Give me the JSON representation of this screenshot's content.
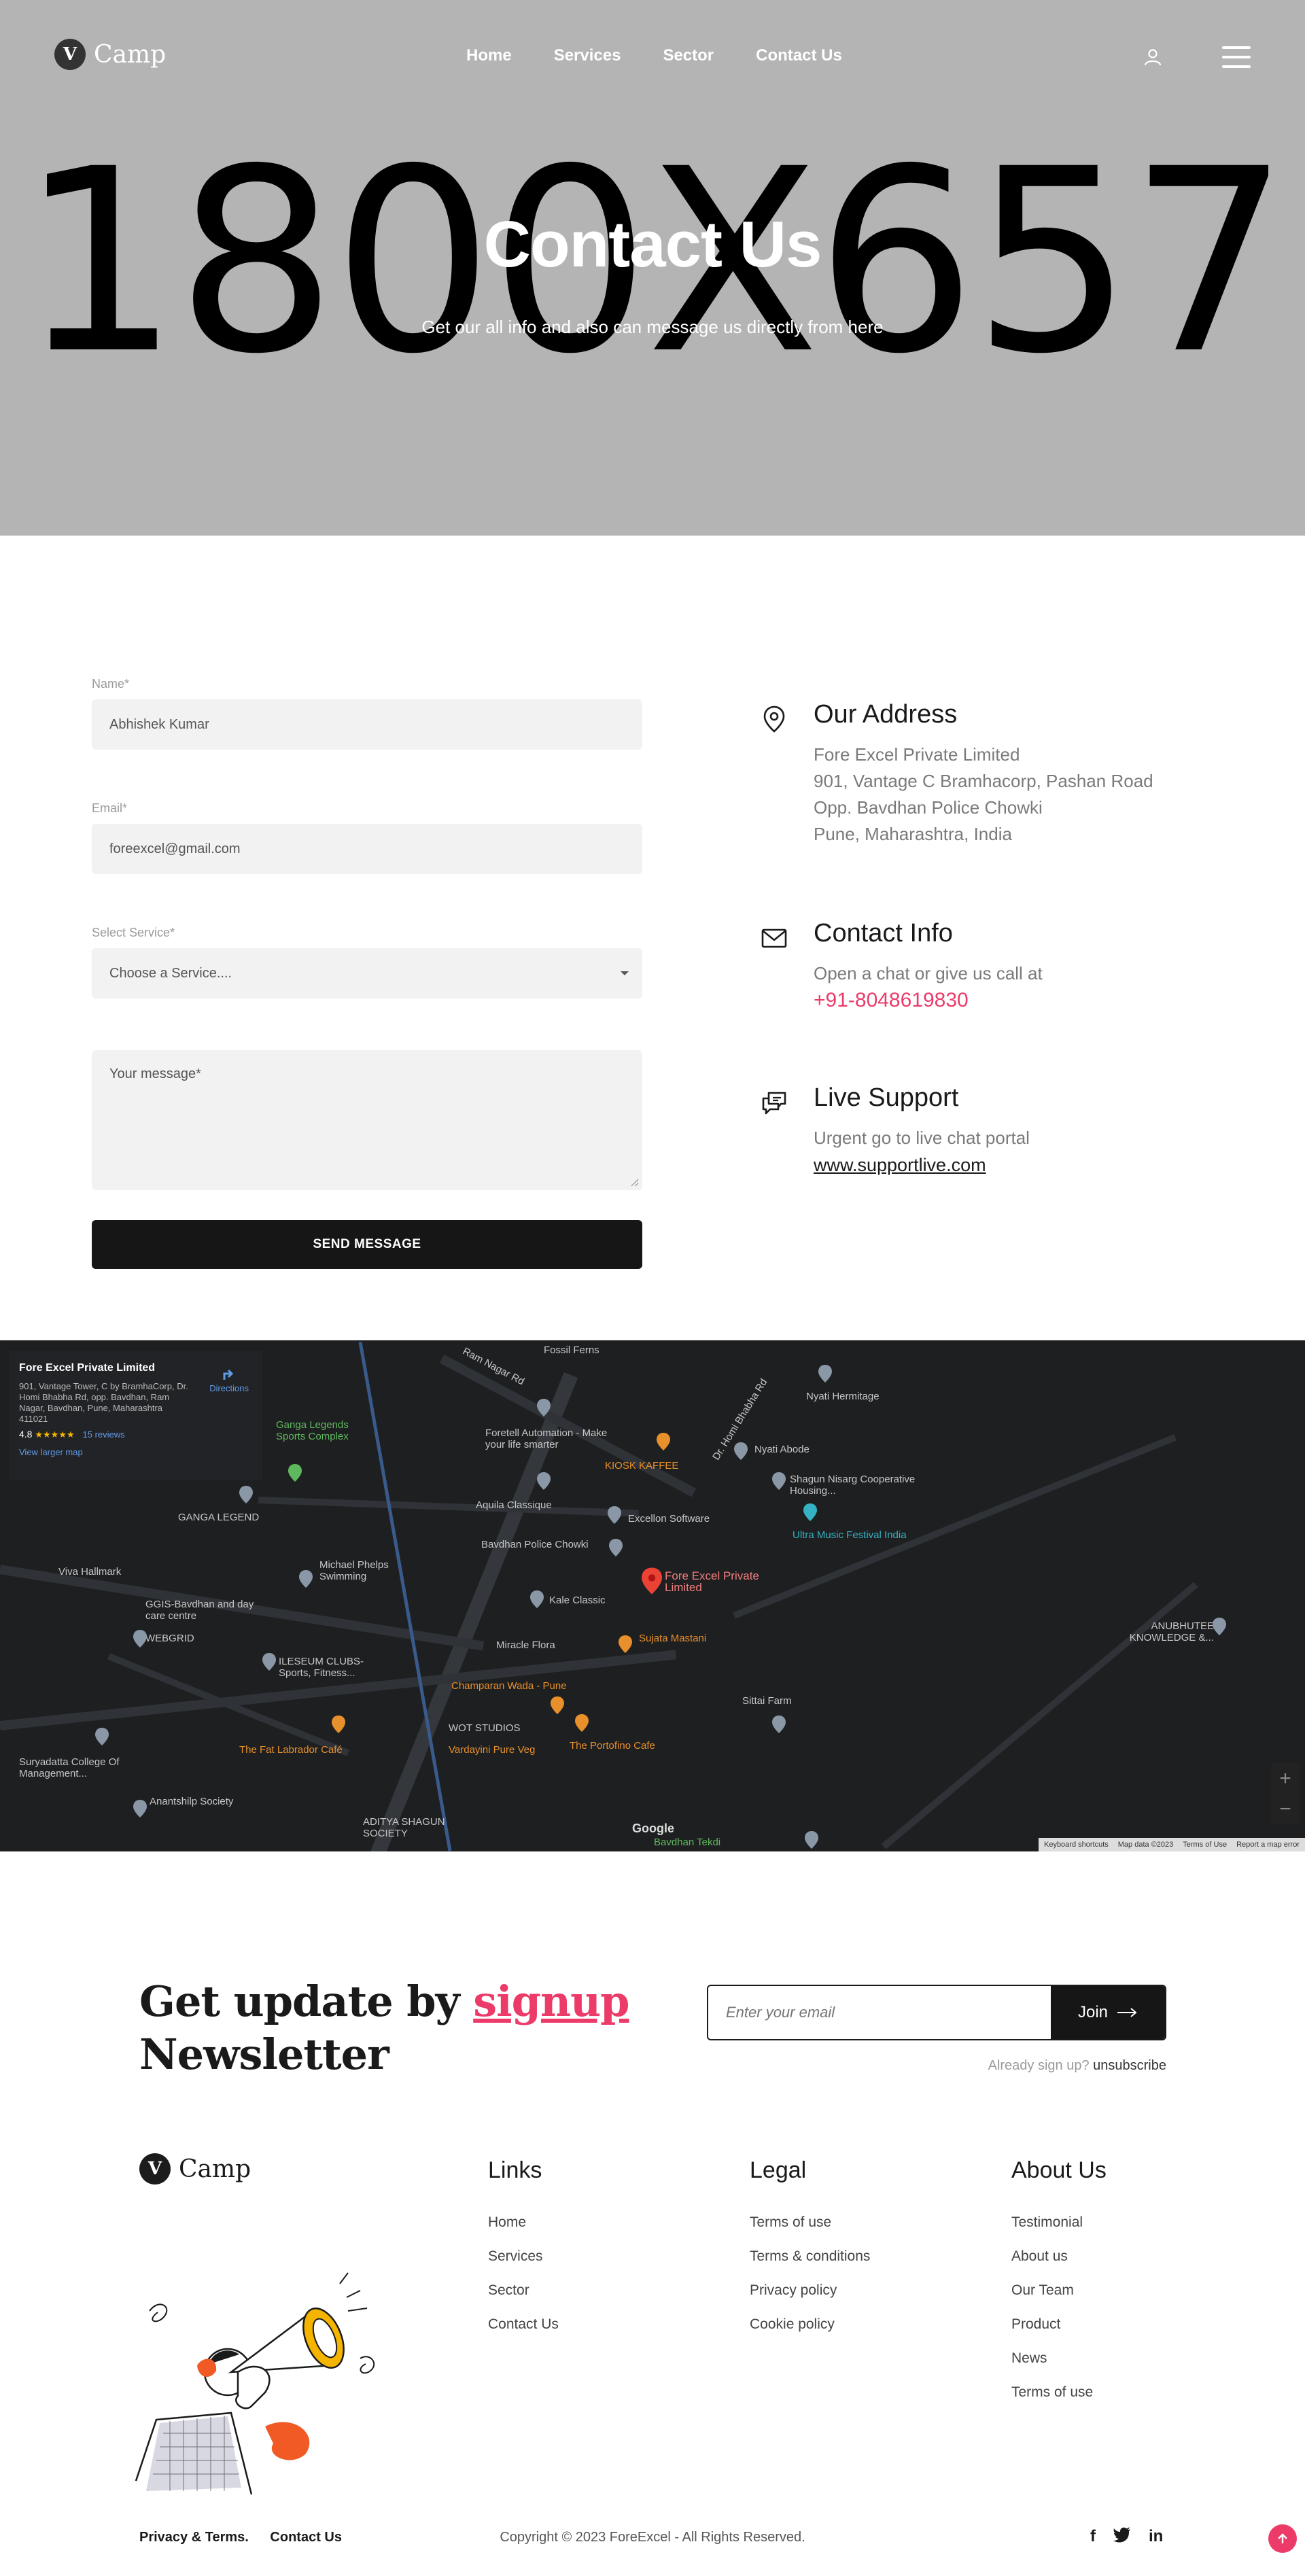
{
  "header": {
    "logo_letter": "V",
    "logo_text": "Camp",
    "nav": [
      "Home",
      "Services",
      "Sector",
      "Contact Us"
    ]
  },
  "hero": {
    "placeholder": "1800X657",
    "title": "Contact Us",
    "subtitle": "Get our all info and also can message us directly from here"
  },
  "form": {
    "name_label": "Name*",
    "name_value": "Abhishek Kumar",
    "email_label": "Email*",
    "email_value": "foreexcel@gmail.com",
    "service_label": "Select Service*",
    "service_value": "Choose a Service....",
    "message_placeholder": "Your message*",
    "submit_label": "SEND MESSAGE"
  },
  "contact": {
    "address_title": "Our Address",
    "address_lines": [
      "Fore Excel Private Limited",
      "901, Vantage C Bramhacorp, Pashan Road",
      "Opp. Bavdhan Police Chowki",
      "Pune, Maharashtra, India"
    ],
    "info_title": "Contact Info",
    "info_text": "Open a chat or give us call at",
    "phone": "+91-8048619830",
    "support_title": "Live Support",
    "support_text": "Urgent go to live chat portal",
    "support_link": "www.supportlive.com"
  },
  "map": {
    "card_title": "Fore Excel Private Limited",
    "card_address": "901, Vantage Tower, C by BramhaCorp, Dr. Homi Bhabha Rd, opp. Bavdhan, Ram Nagar, Bavdhan, Pune, Maharashtra 411021",
    "rating": "4.8",
    "stars": "★★★★★",
    "reviews": "15 reviews",
    "larger_map": "View larger map",
    "directions": "Directions",
    "zoom_in": "+",
    "zoom_out": "−",
    "google": "Google",
    "footer_links": [
      "Keyboard shortcuts",
      "Map data ©2023",
      "Terms of Use",
      "Report a map error"
    ],
    "places": [
      {
        "name": "Fossil Ferns"
      },
      {
        "name": "Ram Nagar Rd"
      },
      {
        "name": "Dr. Homi Bhabha Rd"
      },
      {
        "name": "Nyati Hermitage"
      },
      {
        "name": "Foretell Automation - Make your life smarter"
      },
      {
        "name": "KIOSK KAFFEE"
      },
      {
        "name": "Nyati Abode"
      },
      {
        "name": "Ganga Legends Sports Complex"
      },
      {
        "name": "Shagun Nisarg Cooperative Housing..."
      },
      {
        "name": "GANGA LEGEND"
      },
      {
        "name": "Aquila Classique"
      },
      {
        "name": "Excellon Software"
      },
      {
        "name": "Ultra Music Festival India"
      },
      {
        "name": "Bavdhan Police Chowki"
      },
      {
        "name": "Viva Hallmark"
      },
      {
        "name": "Michael Phelps Swimming"
      },
      {
        "name": "Fore Excel Private Limited"
      },
      {
        "name": "GGIS-Bavdhan and day care centre"
      },
      {
        "name": "Kale Classic"
      },
      {
        "name": "WEBGRID"
      },
      {
        "name": "ANUBHUTEE KNOWLEDGE &..."
      },
      {
        "name": "Sujata Mastani"
      },
      {
        "name": "Miracle Flora"
      },
      {
        "name": "ILESEUM CLUBS- Sports, Fitness..."
      },
      {
        "name": "Champaran Wada - Pune"
      },
      {
        "name": "Sittai Farm"
      },
      {
        "name": "WOT STUDIOS"
      },
      {
        "name": "The Fat Labrador Café"
      },
      {
        "name": "Vardayini Pure Veg"
      },
      {
        "name": "The Portofino Cafe"
      },
      {
        "name": "Suryadatta College Of Management..."
      },
      {
        "name": "Anantshilp Society"
      },
      {
        "name": "ADITYA SHAGUN SOCIETY"
      },
      {
        "name": "Bavdhan Tekdi"
      }
    ]
  },
  "newsletter": {
    "title_a": "Get update by ",
    "title_link": "signup",
    "title_b": "Newsletter",
    "placeholder": "Enter your email",
    "join_label": "Join",
    "already": "Already sign up? ",
    "unsubscribe": "unsubscribe"
  },
  "footer": {
    "logo_letter": "V",
    "logo_text": "Camp",
    "columns": [
      {
        "title": "Links",
        "items": [
          "Home",
          "Services",
          "Sector",
          "Contact Us"
        ]
      },
      {
        "title": "Legal",
        "items": [
          "Terms of use",
          "Terms & conditions",
          "Privacy policy",
          "Cookie policy"
        ]
      },
      {
        "title": "About Us",
        "items": [
          "Testimonial",
          "About us",
          "Our Team",
          "Product",
          "News",
          "Terms of use"
        ]
      }
    ],
    "bottom_links": [
      "Privacy & Terms.",
      "Contact Us"
    ],
    "copyright": "Copyright © 2023 ForeExcel - All Rights Reserved.",
    "social": [
      "f",
      "t",
      "in"
    ]
  },
  "colors": {
    "accent": "#ec3b69",
    "hero_bg": "#b4b4b4",
    "dark": "#161616",
    "map_bg": "#1e1f21"
  }
}
